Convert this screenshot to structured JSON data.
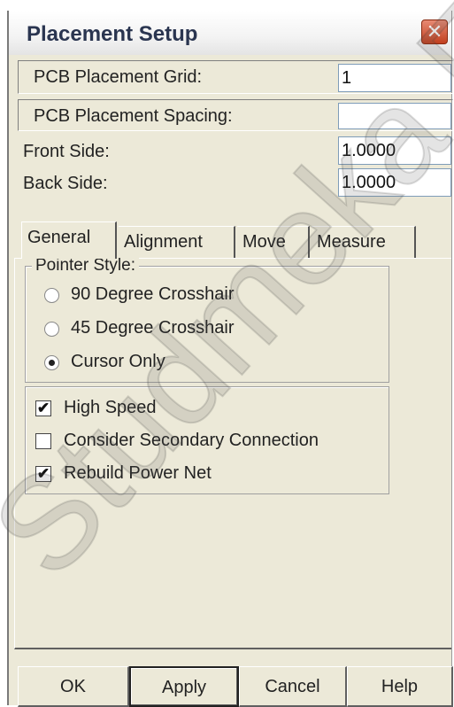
{
  "dialog": {
    "title": "Placement Setup",
    "close_glyph": "✕"
  },
  "fields": {
    "grid_label": "PCB Placement Grid:",
    "grid_value": "1",
    "spacing_label": "PCB Placement Spacing:",
    "spacing_value": "",
    "front_label": "Front Side:",
    "front_value": "1.0000",
    "back_label": "Back Side:",
    "back_value": "1.0000"
  },
  "tabs": [
    {
      "label": "General",
      "active": true
    },
    {
      "label": "Alignment",
      "active": false
    },
    {
      "label": "Move",
      "active": false
    },
    {
      "label": "Measure",
      "active": false
    }
  ],
  "pointer_style": {
    "legend": "Pointer Style:",
    "options": [
      {
        "label": "90 Degree Crosshair",
        "selected": false
      },
      {
        "label": "45 Degree Crosshair",
        "selected": false
      },
      {
        "label": "Cursor Only",
        "selected": true
      }
    ]
  },
  "options": [
    {
      "label": "High Speed",
      "checked": true
    },
    {
      "label": "Consider Secondary Connection",
      "checked": false
    },
    {
      "label": "Rebuild Power Net",
      "checked": true
    }
  ],
  "buttons": {
    "ok": "OK",
    "apply": "Apply",
    "cancel": "Cancel",
    "help": "Help"
  },
  "check_glyph": "✔",
  "watermark": "Studmeka E"
}
